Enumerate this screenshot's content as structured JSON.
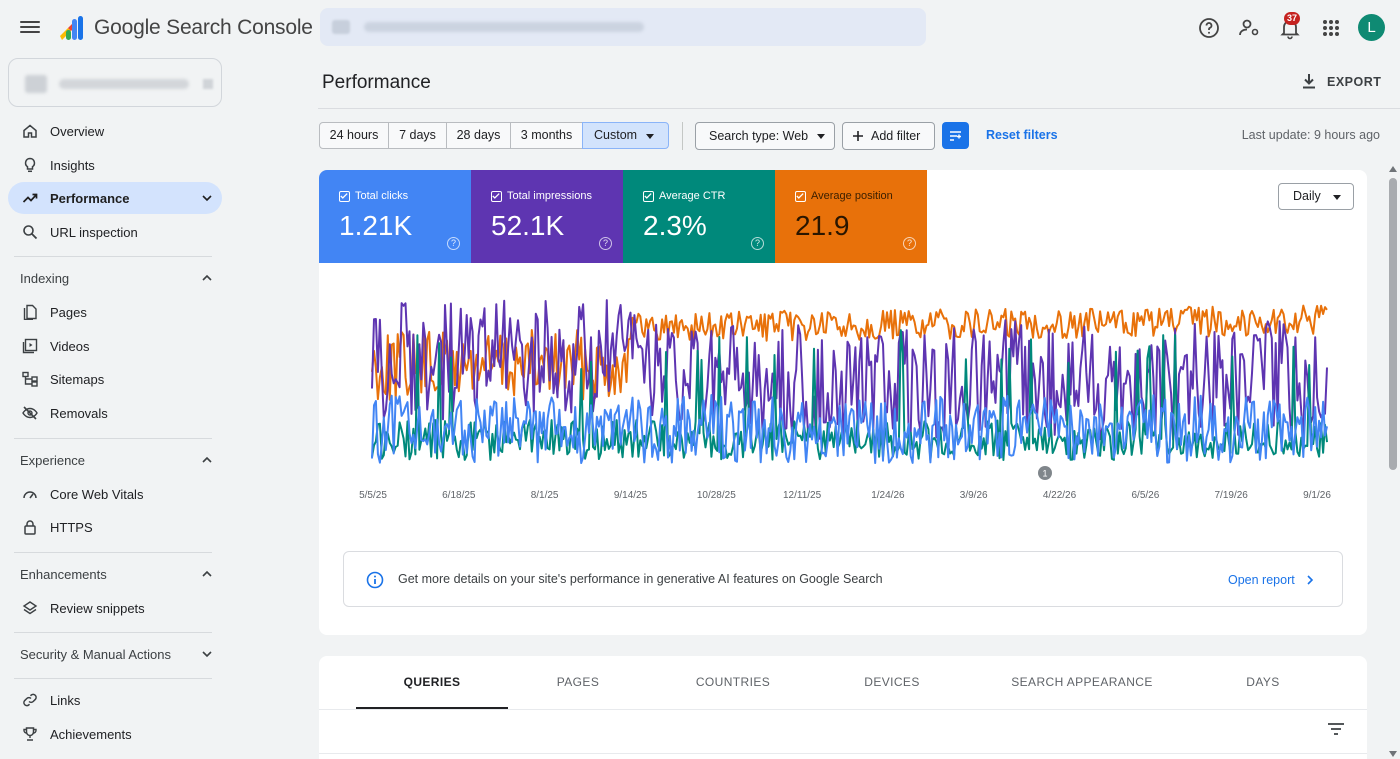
{
  "app": {
    "title": "Google Search Console"
  },
  "topbar": {
    "notification_count": "37",
    "avatar_letter": "L"
  },
  "sidebar": {
    "items": [
      {
        "label": "Overview",
        "icon": "home-icon"
      },
      {
        "label": "Insights",
        "icon": "lightbulb-icon"
      },
      {
        "label": "Performance",
        "icon": "trending-up-icon",
        "active": true
      },
      {
        "label": "URL inspection",
        "icon": "search-icon"
      }
    ],
    "sections": [
      {
        "label": "Indexing",
        "items": [
          {
            "label": "Pages",
            "icon": "pages-icon"
          },
          {
            "label": "Videos",
            "icon": "video-icon"
          },
          {
            "label": "Sitemaps",
            "icon": "sitemap-icon"
          },
          {
            "label": "Removals",
            "icon": "eye-off-icon"
          }
        ]
      },
      {
        "label": "Experience",
        "items": [
          {
            "label": "Core Web Vitals",
            "icon": "gauge-icon"
          },
          {
            "label": "HTTPS",
            "icon": "lock-icon"
          }
        ]
      },
      {
        "label": "Enhancements",
        "items": [
          {
            "label": "Review snippets",
            "icon": "layers-icon"
          }
        ]
      },
      {
        "label": "Security & Manual Actions",
        "items": []
      }
    ],
    "bottom_items": [
      {
        "label": "Links",
        "icon": "link-icon"
      },
      {
        "label": "Achievements",
        "icon": "trophy-icon"
      }
    ]
  },
  "main": {
    "title": "Performance",
    "export_label": "EXPORT",
    "date_ranges": [
      "24 hours",
      "7 days",
      "28 days",
      "3 months",
      "Custom"
    ],
    "selected_range": "Custom",
    "search_type": "Search type: Web",
    "add_filter": "Add filter",
    "reset_filters": "Reset filters",
    "last_update": "Last update: 9 hours ago"
  },
  "metrics": [
    {
      "label": "Total clicks",
      "value": "1.21K",
      "color": "#4285f4"
    },
    {
      "label": "Total impressions",
      "value": "52.1K",
      "color": "#5e35b1"
    },
    {
      "label": "Average CTR",
      "value": "2.3%",
      "color": "#00897b"
    },
    {
      "label": "Average position",
      "value": "21.9",
      "color": "#e8710a"
    }
  ],
  "granularity": "Daily",
  "chart_data": {
    "type": "line",
    "x_tick_labels": [
      "5/5/25",
      "6/18/25",
      "8/1/25",
      "9/14/25",
      "10/28/25",
      "12/11/25",
      "1/24/26",
      "3/9/26",
      "4/22/26",
      "6/5/26",
      "7/19/26",
      "9/1/26"
    ],
    "series": [
      {
        "name": "Total clicks",
        "color": "#4285f4"
      },
      {
        "name": "Total impressions",
        "color": "#5e35b1"
      },
      {
        "name": "Average CTR",
        "color": "#00897b"
      },
      {
        "name": "Average position",
        "color": "#e8710a"
      }
    ],
    "annotation": "1",
    "grid": false
  },
  "ai_notice": {
    "text": "Get more details on your site's performance in generative AI features on Google Search",
    "link": "Open report"
  },
  "tabs": [
    "QUERIES",
    "PAGES",
    "COUNTRIES",
    "DEVICES",
    "SEARCH APPEARANCE",
    "DAYS"
  ],
  "active_tab": "QUERIES"
}
